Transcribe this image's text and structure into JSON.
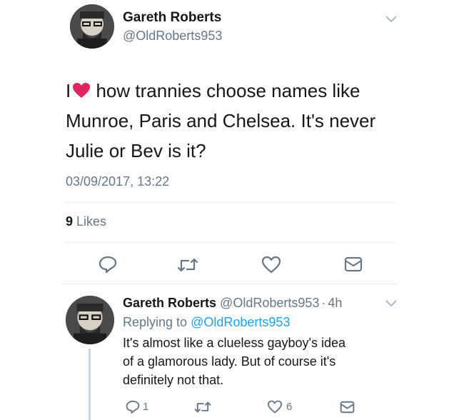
{
  "main_tweet": {
    "author_name": "Gareth Roberts",
    "author_handle": "@OldRoberts953",
    "text_prefix": "I",
    "text_line1_rest": " how trannies choose names like",
    "text_line2": "Munroe, Paris and Chelsea. It's never",
    "text_line3": "Julie or Bev is it?",
    "timestamp": "03/09/2017, 13:22",
    "likes_count": "9",
    "likes_label": "Likes"
  },
  "reply_tweet": {
    "author_name": "Gareth Roberts",
    "author_handle": "@OldRoberts953",
    "separator": "·",
    "time_ago": "4h",
    "replying_prefix": "Replying to",
    "replying_handle": "@OldRoberts953",
    "text_line1": "It's almost like a clueless gayboy's idea",
    "text_line2": "of a glamorous lady. But of course it's",
    "text_line3": "definitely not that.",
    "reply_count": "1",
    "like_count": "6"
  },
  "colors": {
    "text": "#14171a",
    "muted": "#657786",
    "link": "#1da1f2",
    "heart": "#e0245e",
    "divider": "#e1e8ed"
  },
  "icons": [
    "avatar",
    "chevron-down-icon",
    "heart-emoji-icon",
    "reply-icon",
    "retweet-icon",
    "like-icon",
    "dm-icon"
  ]
}
